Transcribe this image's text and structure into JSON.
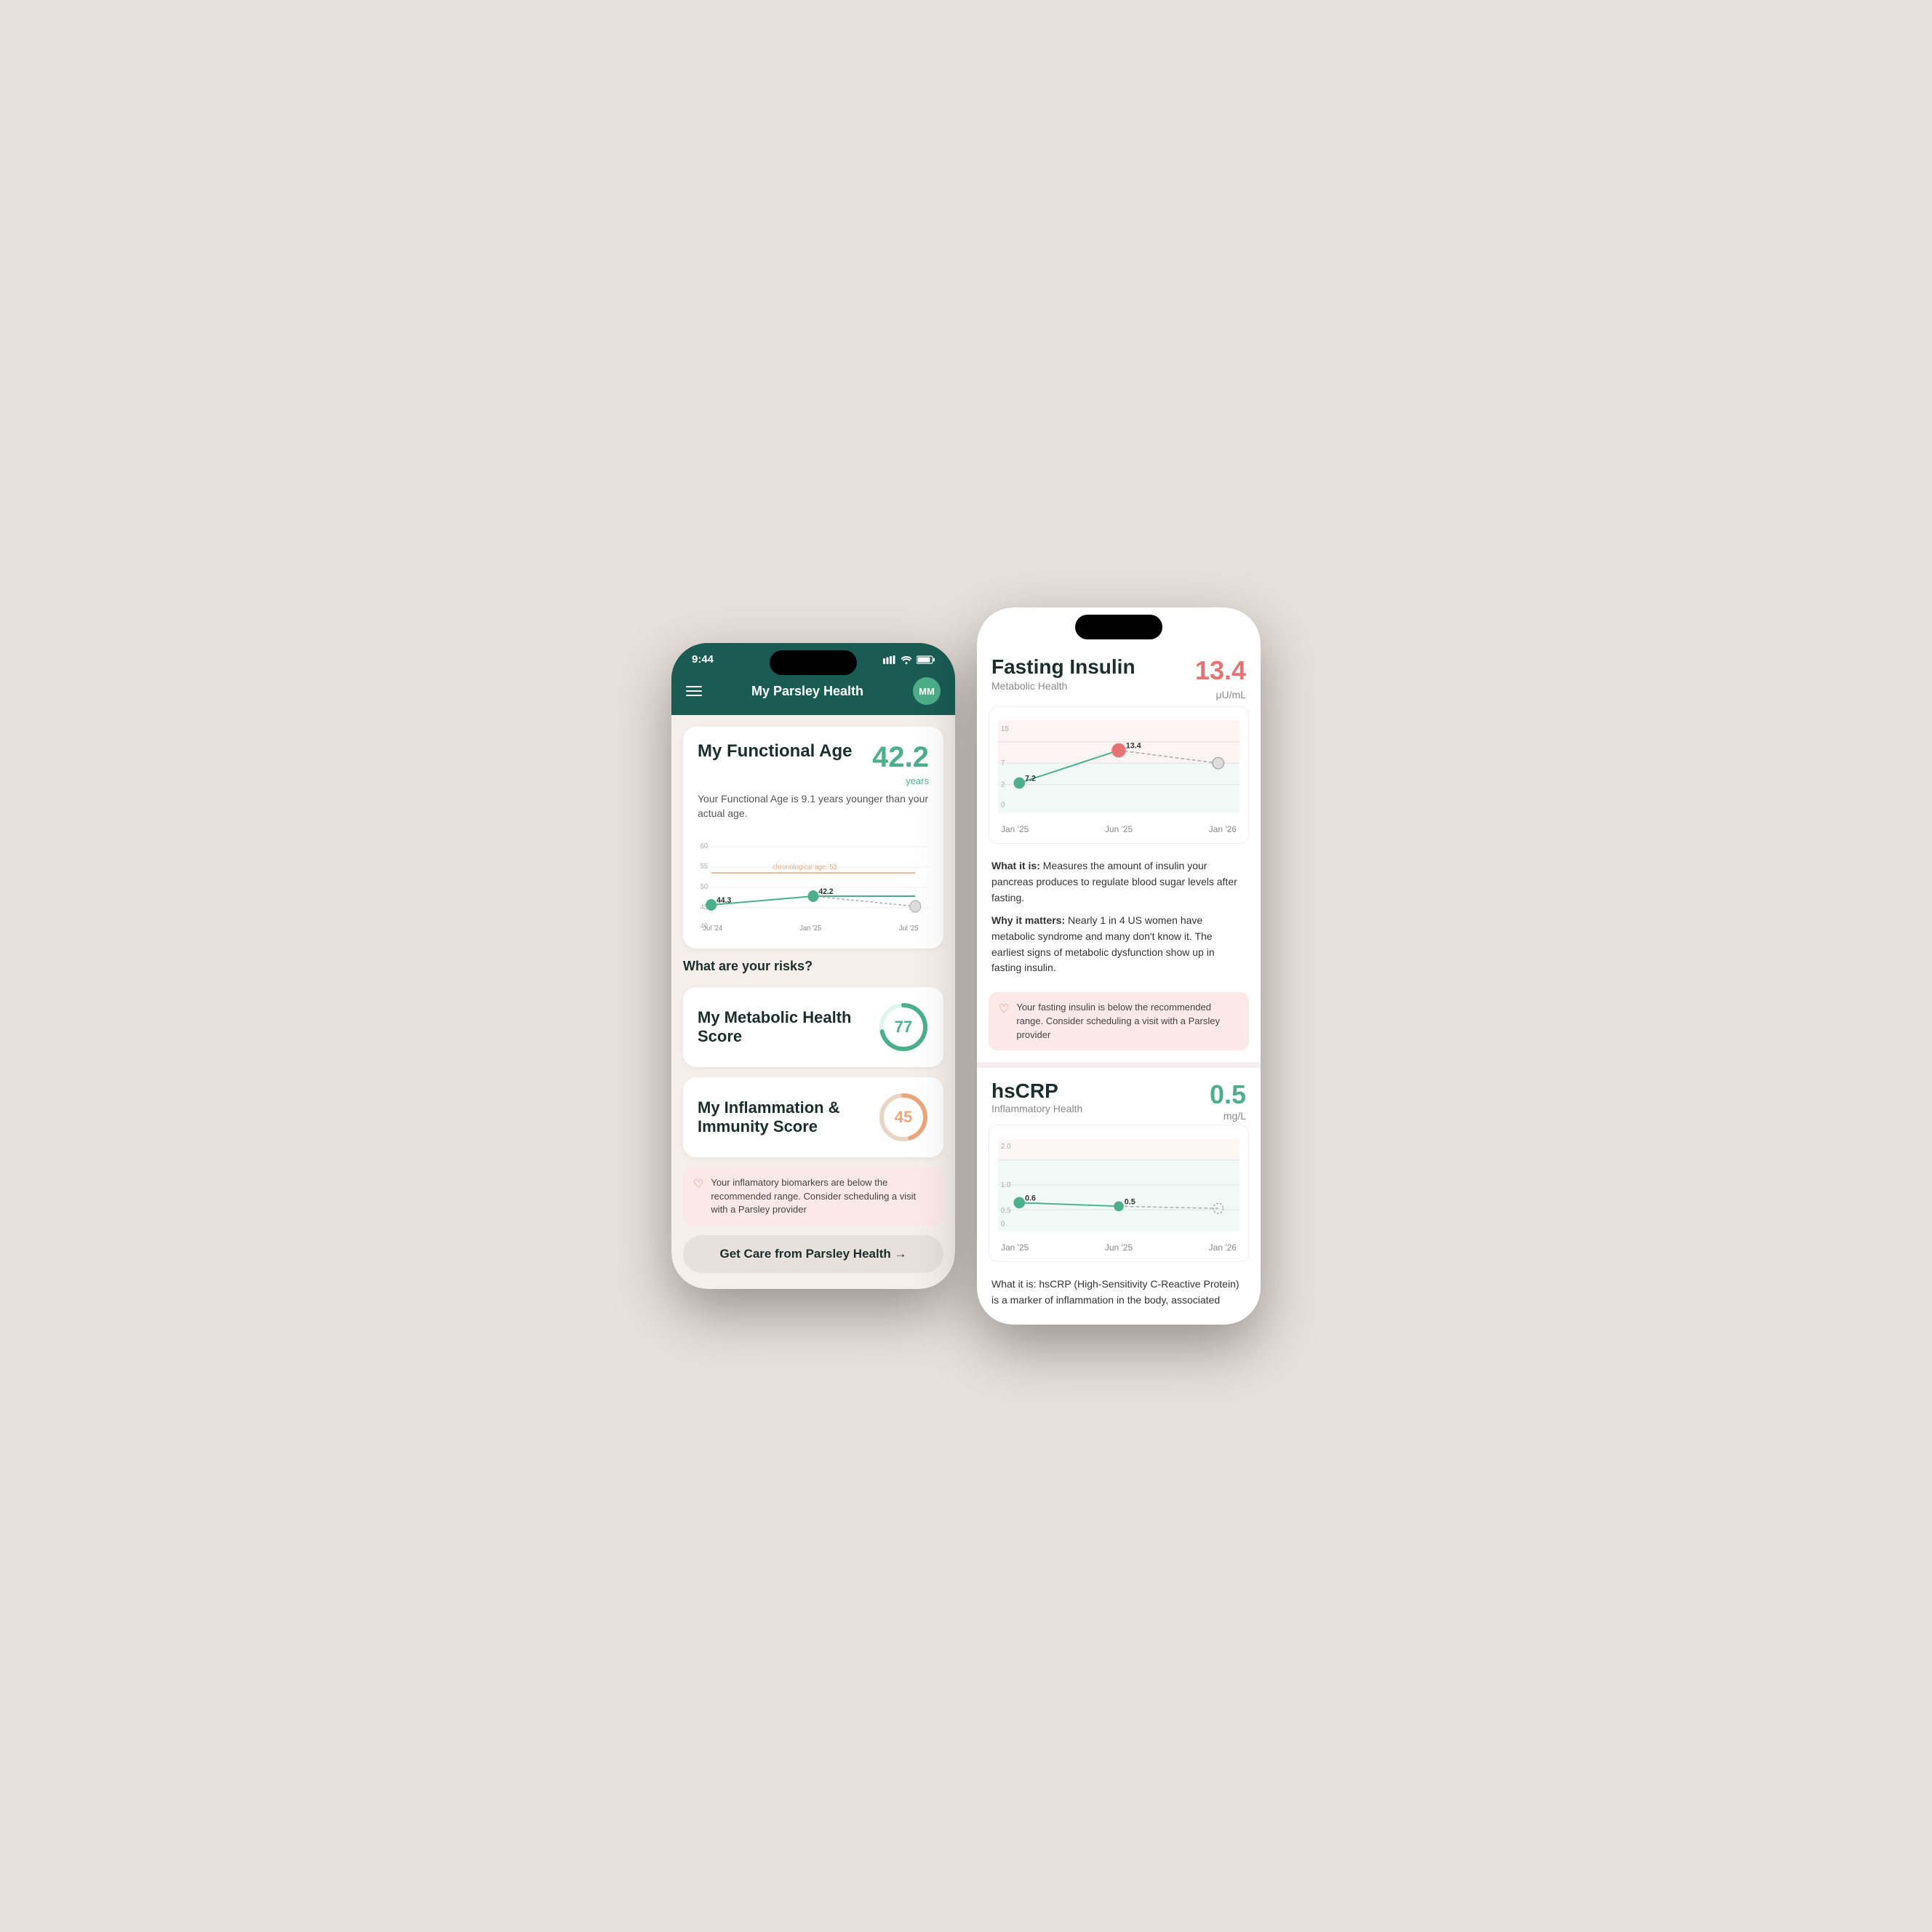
{
  "leftPhone": {
    "statusBar": {
      "time": "9:44",
      "icons": "●●● ▲ ▬"
    },
    "header": {
      "title_prefix": "My ",
      "title_brand": "Parsley Health",
      "avatar_initials": "MM"
    },
    "functionalAge": {
      "title": "My Functional Age",
      "value": "42.2",
      "unit": "years",
      "subtitle": "Your Functional Age is 9.1 years younger than your actual age.",
      "chart": {
        "chronological_label": "chronological age: 53",
        "point1_label": "44.3",
        "point2_label": "42.2",
        "x_labels": [
          "Jul '24",
          "Jan '25",
          "Jul '25"
        ],
        "y_values": [
          40,
          45,
          50,
          55,
          60
        ]
      }
    },
    "risks": {
      "section_title": "What are your risks?",
      "metabolicScore": {
        "title": "My Metabolic Health Score",
        "value": "77",
        "color": "#4caf8a"
      },
      "inflammationScore": {
        "title": "My Inflammation & Immunity Score",
        "value": "45",
        "color": "#e8a87c"
      },
      "alert_text": "Your inflamatory biomarkers are below the recommended range. Consider scheduling a visit with a Parsley provider"
    },
    "getCare": {
      "label": "Get Care from Parsley Health →"
    }
  },
  "rightPhone": {
    "fastingInsulin": {
      "title": "Fasting Insulin",
      "category": "Metabolic Health",
      "value": "13.4",
      "unit": "μU/mL",
      "chart": {
        "point1_value": "7.2",
        "point1_x": "Jan '25",
        "point2_value": "13.4",
        "point2_x": "Jun '25",
        "point3_x": "Jan '26",
        "x_labels": [
          "Jan '25",
          "Jun '25",
          "Jan '26"
        ]
      },
      "what_it_is": "Measures the amount of insulin your pancreas produces to regulate blood sugar levels after fasting.",
      "why_it_matters": "Nearly 1 in 4 US women have metabolic syndrome and many don't know it. The earliest signs of metabolic dysfunction show up in fasting insulin.",
      "alert_text": "Your fasting insulin is below the recommended range. Consider scheduling a visit with a Parsley provider"
    },
    "hsCRP": {
      "title": "hsCRP",
      "category": "Inflammatory Health",
      "value": "0.5",
      "unit": "mg/L",
      "chart": {
        "point1_value": "0.6",
        "point1_x": "Jan '25",
        "point2_value": "0.5",
        "point2_x": "Jun '25",
        "point3_x": "Jan '26",
        "x_labels": [
          "Jan '25",
          "Jun '25",
          "Jan '26"
        ]
      },
      "what_it_is_text": "What it is: hsCRP (High-Sensitivity C-Reactive Protein) is a marker of inflammation in the body, associated"
    }
  }
}
